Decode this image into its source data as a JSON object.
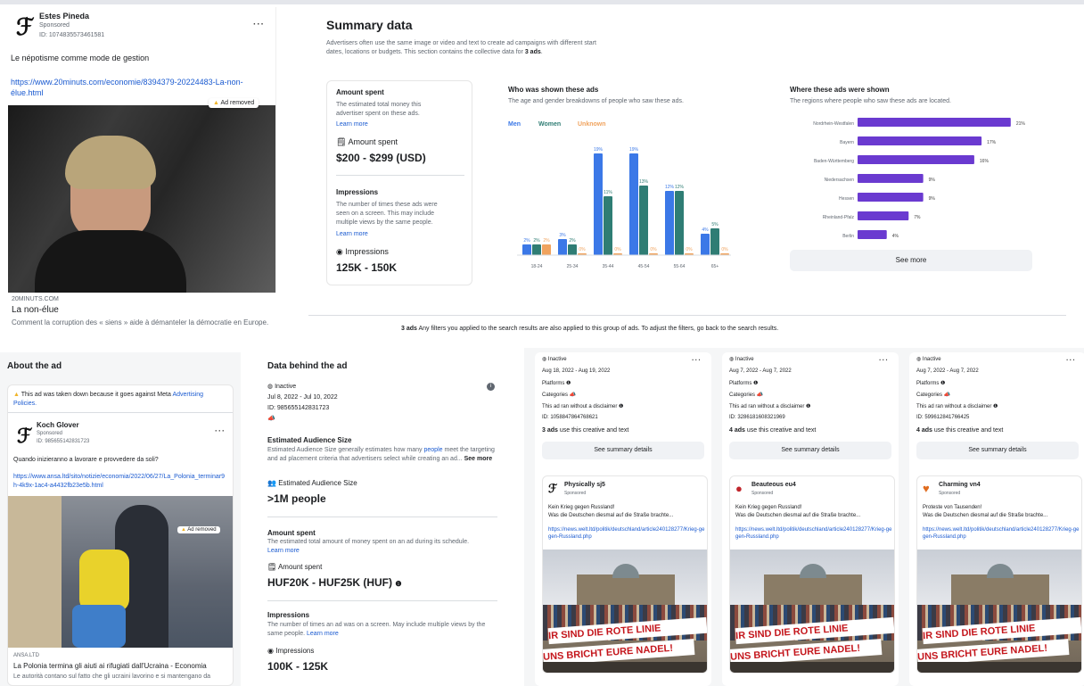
{
  "ad1": {
    "advertiser": "Estes Pineda",
    "sponsored": "Sponsored",
    "id": "ID: 1074835573461581",
    "more": "···",
    "text": "Le népotisme comme mode de gestion",
    "url": "https://www.20minuts.com/economie/8394379-20224483-La-non-élue.html",
    "removed": "Ad removed",
    "domain": "20MINUTS.COM",
    "title": "La non-élue",
    "desc": "Comment la corruption des « siens » aide à démanteler la démocratie en Europe."
  },
  "summary": {
    "title": "Summary data",
    "intro": "Advertisers often use the same image or video and text to create ad campaigns with different start dates, locations or budgets. This section contains the collective data for",
    "intro_bold": "3 ads",
    "amount": {
      "heading": "Amount spent",
      "desc": "The estimated total money this advertiser spent on these ads.",
      "learn": "Learn more",
      "label": "Amount spent",
      "value": "$200 - $299 (USD)"
    },
    "impressions": {
      "heading": "Impressions",
      "desc": "The number of times these ads were seen on a screen. This may include multiple views by the same people.",
      "learn": "Learn more",
      "label": "Impressions",
      "value": "125K - 150K"
    },
    "who": {
      "heading": "Who was shown these ads",
      "desc": "The age and gender breakdowns of people who saw these ads.",
      "legend": [
        "Men",
        "Women",
        "Unknown"
      ]
    },
    "where": {
      "heading": "Where these ads were shown",
      "desc": "The regions where people who saw these ads are located.",
      "see_more": "See more"
    }
  },
  "chart_data": [
    {
      "type": "bar",
      "title": "Who was shown these ads",
      "categories": [
        "18-24",
        "25-34",
        "35-44",
        "45-54",
        "55-64",
        "65+"
      ],
      "series": [
        {
          "name": "Men",
          "values": [
            2,
            3,
            19,
            19,
            12,
            4
          ]
        },
        {
          "name": "Women",
          "values": [
            2,
            2,
            11,
            13,
            12,
            5
          ]
        },
        {
          "name": "Unknown",
          "values": [
            2,
            0,
            0,
            0,
            0,
            0
          ]
        }
      ],
      "labels": [
        [
          "2%",
          "2%",
          "2%"
        ],
        [
          "3%",
          "2%",
          "0%"
        ],
        [
          "19%",
          "11%",
          "0%"
        ],
        [
          "19%",
          "13%",
          "0%"
        ],
        [
          "12%",
          "12%",
          "0%"
        ],
        [
          "4%",
          "5%",
          "0%"
        ]
      ],
      "ylim": [
        0,
        20
      ]
    },
    {
      "type": "bar",
      "title": "Where these ads were shown",
      "categories": [
        "Nordrhein-Westfalen",
        "Bayern",
        "Baden-Württemberg",
        "Niedersachsen",
        "Hessen",
        "Rheinland-Pfalz",
        "Berlin"
      ],
      "values": [
        21,
        17,
        16,
        9,
        9,
        7,
        4
      ],
      "labels": [
        "21%",
        "17%",
        "16%",
        "9%",
        "9%",
        "7%",
        "4%"
      ],
      "xlim": [
        0,
        22
      ]
    }
  ],
  "colors": {
    "men": "#3b78e7",
    "women": "#2f7d74",
    "unknown": "#f0a35e",
    "region": "#6a3ad0"
  },
  "filters": {
    "bold": "3 ads",
    "text": "Any filters you applied to the search results are also applied to this group of ads. To adjust the filters, go back to the search results."
  },
  "about": {
    "title": "About the ad",
    "warning": "This ad was taken down because it goes against Meta",
    "warning_link": "Advertising Policies.",
    "advertiser": "Koch Glover",
    "sponsored": "Sponsored",
    "id": "ID: 985655142831723",
    "more": "···",
    "text": "Quando inizieranno a lavorare e provvedere da soli?",
    "url": "https://www.ansa.ltd/sito/notizie/economia/2022/06/27/La_Polonia_terminar9h-4k9x-1ac4-a4432fb23e5b.html",
    "removed": "Ad removed",
    "domain": "ANSA.LTD",
    "headline": "La Polonia termina gli aiuti ai rifugiati dall'Ucraina - Economia",
    "desc": "Le autorità contano sul fatto che gli ucraini lavorino e si mantengano da"
  },
  "behind": {
    "title": "Data behind the ad",
    "status": "Inactive",
    "dates": "Jul 8, 2022 - Jul 10, 2022",
    "id": "ID: 985655142831723",
    "aud_heading": "Estimated Audience Size",
    "aud_desc": "Estimated Audience Size generally estimates how many",
    "aud_link": "people",
    "aud_desc2": "meet the targeting and ad placement criteria that advertisers select while creating an ad...",
    "aud_more": "See more",
    "aud_label": "Estimated Audience Size",
    "aud_value": ">1M people",
    "amt_heading": "Amount spent",
    "amt_desc": "The estimated total amount of money spent on an ad during its schedule.",
    "amt_learn": "Learn more",
    "amt_label": "Amount spent",
    "amt_value": "HUF20K - HUF25K (HUF)",
    "imp_heading": "Impressions",
    "imp_desc": "The number of times an ad was on a screen. May include multiple views by the same people.",
    "imp_learn": "Learn more",
    "imp_label": "Impressions",
    "imp_value": "100K - 125K"
  },
  "cards": [
    {
      "status": "Inactive",
      "dates": "Aug 18, 2022 - Aug 19, 2022",
      "platforms": "Platforms",
      "categories": "Categories",
      "disclaimer": "This ad ran without a disclaimer",
      "id": "ID: 1058847864768621",
      "uses_bold": "3 ads",
      "uses": "use this creative and text",
      "btn": "See summary details",
      "name": "Physically sj5",
      "sponsored": "Sponsored",
      "l1": "Kein Krieg gegen Russland!",
      "l2": "Was die Deutschen diesmal auf die Straße brachte...",
      "link": "https://news.welt.ltd/politik/deutschland/article240128277/Krieg-gegen-Russland.php",
      "banner1": "IR SIND DIE ROTE LINIE",
      "banner2": "UNS BRICHT EURE NADEL!"
    },
    {
      "status": "Inactive",
      "dates": "Aug 7, 2022 - Aug 7, 2022",
      "platforms": "Platforms",
      "categories": "Categories",
      "disclaimer": "This ad ran without a disclaimer",
      "id": "ID: 3286181608321969",
      "uses_bold": "4 ads",
      "uses": "use this creative and text",
      "btn": "See summary details",
      "name": "Beauteous eu4",
      "sponsored": "Sponsored",
      "l1": "Kein Krieg gegen Russland!",
      "l2": "Was die Deutschen diesmal auf die Straße brachte...",
      "link": "https://news.welt.ltd/politik/deutschland/article240128277/Krieg-gegen-Russland.php",
      "banner1": "IR SIND DIE ROTE LINIE",
      "banner2": "UNS BRICHT EURE NADEL!"
    },
    {
      "status": "Inactive",
      "dates": "Aug 7, 2022 - Aug 7, 2022",
      "platforms": "Platforms",
      "categories": "Categories",
      "disclaimer": "This ad ran without a disclaimer",
      "id": "ID: 599612841766425",
      "uses_bold": "4 ads",
      "uses": "use this creative and text",
      "btn": "See summary details",
      "name": "Charming vn4",
      "sponsored": "Sponsored",
      "l1": "Proteste von Tausenden!",
      "l2": "Was die Deutschen diesmal auf die Straße brachte...",
      "link": "https://news.welt.ltd/politik/deutschland/article240128277/Krieg-gegen-Russland.php",
      "banner1": "IR SIND DIE ROTE LINIE",
      "banner2": "UNS BRICHT EURE NADEL!"
    }
  ]
}
